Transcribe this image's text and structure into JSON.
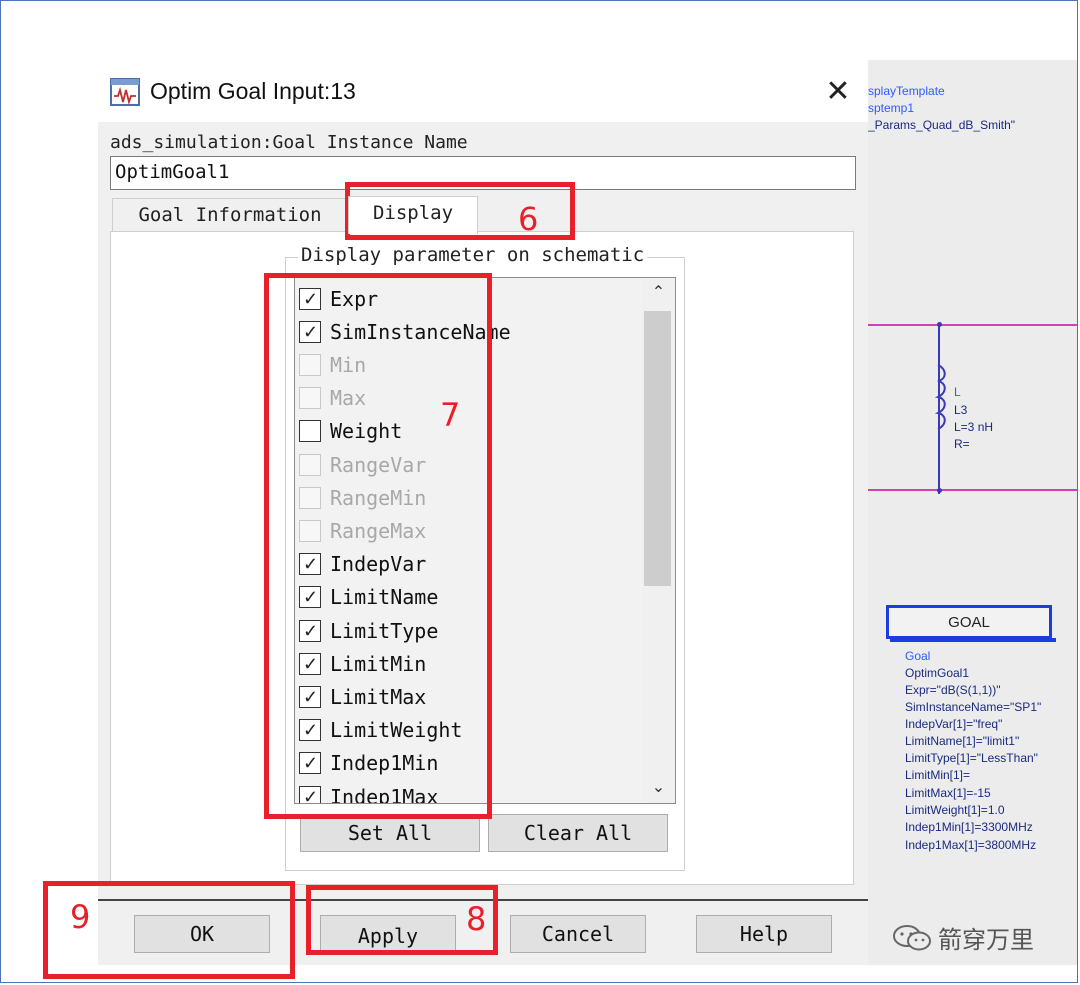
{
  "dialog": {
    "title": "Optim Goal Input:13",
    "close_glyph": "✕",
    "instance_label": "ads_simulation:Goal Instance Name",
    "instance_value": "OptimGoal1",
    "tabs": [
      {
        "label": "Goal Information",
        "active": false
      },
      {
        "label": "Display",
        "active": true
      }
    ],
    "display_group_label": "Display parameter on schematic",
    "params": [
      {
        "label": "Expr",
        "checked": true,
        "enabled": true
      },
      {
        "label": "SimInstanceName",
        "checked": true,
        "enabled": true
      },
      {
        "label": "Min",
        "checked": false,
        "enabled": false
      },
      {
        "label": "Max",
        "checked": false,
        "enabled": false
      },
      {
        "label": "Weight",
        "checked": false,
        "enabled": true
      },
      {
        "label": "RangeVar",
        "checked": false,
        "enabled": false
      },
      {
        "label": "RangeMin",
        "checked": false,
        "enabled": false
      },
      {
        "label": "RangeMax",
        "checked": false,
        "enabled": false
      },
      {
        "label": "IndepVar",
        "checked": true,
        "enabled": true
      },
      {
        "label": "LimitName",
        "checked": true,
        "enabled": true
      },
      {
        "label": "LimitType",
        "checked": true,
        "enabled": true
      },
      {
        "label": "LimitMin",
        "checked": true,
        "enabled": true
      },
      {
        "label": "LimitMax",
        "checked": true,
        "enabled": true
      },
      {
        "label": "LimitWeight",
        "checked": true,
        "enabled": true
      },
      {
        "label": "Indep1Min",
        "checked": true,
        "enabled": true
      },
      {
        "label": "Indep1Max",
        "checked": true,
        "enabled": true
      }
    ],
    "set_all_label": "Set All",
    "clear_all_label": "Clear All",
    "ok_label": "OK",
    "apply_label": "Apply",
    "cancel_label": "Cancel",
    "help_label": "Help",
    "scroll_up_glyph": "⌃",
    "scroll_down_glyph": "⌄"
  },
  "annotations": {
    "n6": "6",
    "n7": "7",
    "n8": "8",
    "n9": "9",
    "color": "#e8202a"
  },
  "schematic": {
    "template_lines": [
      "splayTemplate",
      "sptemp1",
      "_Params_Quad_dB_Smith\""
    ],
    "inductor_lines": [
      "L",
      "L3",
      "L=3 nH",
      "R="
    ],
    "goal_box_label": "GOAL",
    "goal_lines": [
      "Goal",
      "OptimGoal1",
      "Expr=\"dB(S(1,1))\"",
      "SimInstanceName=\"SP1\"",
      "IndepVar[1]=\"freq\"",
      "LimitName[1]=\"limit1\"",
      "LimitType[1]=\"LessThan\"",
      "LimitMin[1]=",
      "LimitMax[1]=-15",
      "LimitWeight[1]=1.0",
      "Indep1Min[1]=3300MHz",
      "Indep1Max[1]=3800MHz"
    ]
  },
  "watermark": {
    "text": "箭穿万里"
  }
}
